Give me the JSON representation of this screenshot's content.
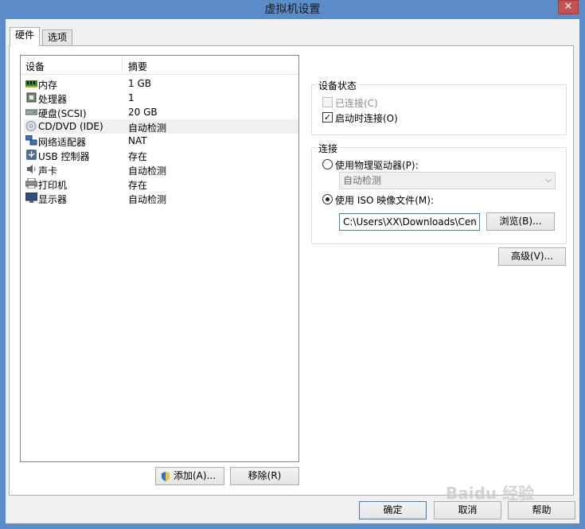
{
  "window": {
    "title": "虚拟机设置",
    "close": "✕"
  },
  "tabs": [
    {
      "label": "硬件"
    },
    {
      "label": "选项"
    }
  ],
  "device_list": {
    "columns": {
      "device": "设备",
      "summary": "摘要"
    },
    "rows": [
      {
        "name": "内存",
        "summary": "1 GB",
        "icon": "memory-icon"
      },
      {
        "name": "处理器",
        "summary": "1",
        "icon": "cpu-icon"
      },
      {
        "name": "硬盘(SCSI)",
        "summary": "20 GB",
        "icon": "harddisk-icon"
      },
      {
        "name": "CD/DVD (IDE)",
        "summary": "自动检测",
        "icon": "cd-dvd-icon"
      },
      {
        "name": "网络适配器",
        "summary": "NAT",
        "icon": "network-adapter-icon"
      },
      {
        "name": "USB 控制器",
        "summary": "存在",
        "icon": "usb-icon"
      },
      {
        "name": "声卡",
        "summary": "自动检测",
        "icon": "sound-card-icon"
      },
      {
        "name": "打印机",
        "summary": "存在",
        "icon": "printer-icon"
      },
      {
        "name": "显示器",
        "summary": "自动检测",
        "icon": "display-icon"
      }
    ],
    "selected_index": 3
  },
  "list_buttons": {
    "add": "添加(A)...",
    "remove": "移除(R)"
  },
  "device_status": {
    "title": "设备状态",
    "connected": {
      "label": "已连接(C)",
      "checked": false
    },
    "connect_at_power_on": {
      "label": "启动时连接(O)",
      "checked": true
    }
  },
  "connection": {
    "title": "连接",
    "use_physical": {
      "label": "使用物理驱动器(P):",
      "selected": false
    },
    "physical_value": "自动检测",
    "use_iso": {
      "label": "使用 ISO 映像文件(M):",
      "selected": true
    },
    "iso_path": "C:\\Users\\XX\\Downloads\\Cen",
    "browse": "浏览(B)..."
  },
  "advanced": "高级(V)...",
  "footer": {
    "ok": "确定",
    "cancel": "取消",
    "help": "帮助"
  },
  "watermark": "Baidu 经验"
}
